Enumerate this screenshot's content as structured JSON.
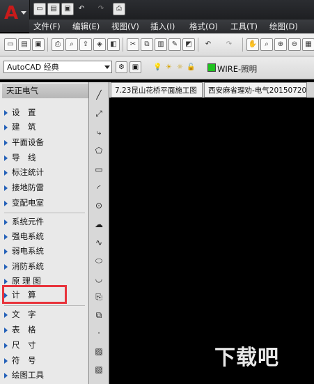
{
  "menu": [
    "文件(F)",
    "编辑(E)",
    "视图(V)",
    "插入(I)",
    "格式(O)",
    "工具(T)",
    "绘图(D)"
  ],
  "workspace": {
    "value": "AutoCAD 经典"
  },
  "layer": {
    "name": "WIRE-照明",
    "color": "#1fc21f"
  },
  "panel": {
    "title": "天正电气",
    "groups": [
      [
        "设　置",
        "建　筑",
        "平面设备",
        "导　线",
        "标注统计",
        "接地防雷",
        "变配电室"
      ],
      [
        "系统元件",
        "强电系统",
        "弱电系统",
        "消防系统",
        "原 理 图",
        "计　算"
      ],
      [
        "文　字",
        "表　格",
        "尺　寸",
        "符　号",
        "绘图工具"
      ]
    ]
  },
  "tabs": [
    "7.23昆山花桥平面施工图",
    "西安麻省理劝-电气20150720"
  ],
  "watermark": "下载吧",
  "highlight_color": "#e8333b"
}
